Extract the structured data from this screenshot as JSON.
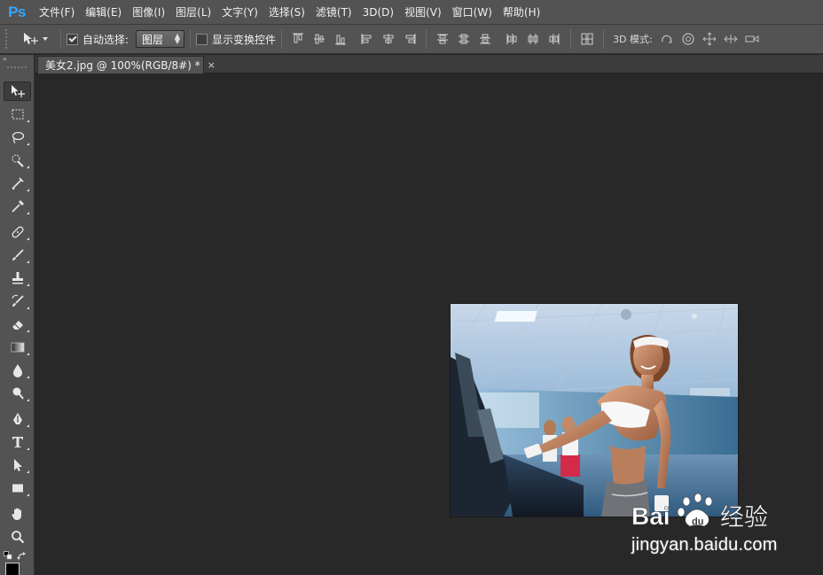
{
  "app": {
    "logo": "Ps"
  },
  "menu": {
    "items": [
      "文件(F)",
      "编辑(E)",
      "图像(I)",
      "图层(L)",
      "文字(Y)",
      "选择(S)",
      "滤镜(T)",
      "3D(D)",
      "视图(V)",
      "窗口(W)",
      "帮助(H)"
    ]
  },
  "options": {
    "auto_select_label": "自动选择:",
    "auto_select_checked": true,
    "auto_select_value": "图层",
    "show_transform_label": "显示变换控件",
    "show_transform_checked": false,
    "mode3d_label": "3D 模式:"
  },
  "document": {
    "tab_title": "美女2.jpg @ 100%(RGB/8#) *",
    "tab_close": "×"
  },
  "toolbar": {
    "collapse_glyph": "»",
    "tools": [
      "move-tool",
      "marquee-tool",
      "lasso-tool",
      "quick-selection-tool",
      "crop-tool",
      "eyedropper-tool",
      "healing-brush-tool",
      "brush-tool",
      "clone-stamp-tool",
      "history-brush-tool",
      "eraser-tool",
      "gradient-tool",
      "blur-tool",
      "dodge-tool",
      "pen-tool",
      "type-tool",
      "path-selection-tool",
      "rectangle-tool",
      "hand-tool",
      "zoom-tool"
    ],
    "active_tool": "move-tool",
    "foreground_color": "#000000"
  },
  "watermark": {
    "brand_left": "Bai",
    "brand_right": "经验",
    "url": "jingyan.baidu.com"
  },
  "colors": {
    "chrome": "#535353",
    "canvas": "#282828",
    "ps_blue": "#31a8ff"
  }
}
